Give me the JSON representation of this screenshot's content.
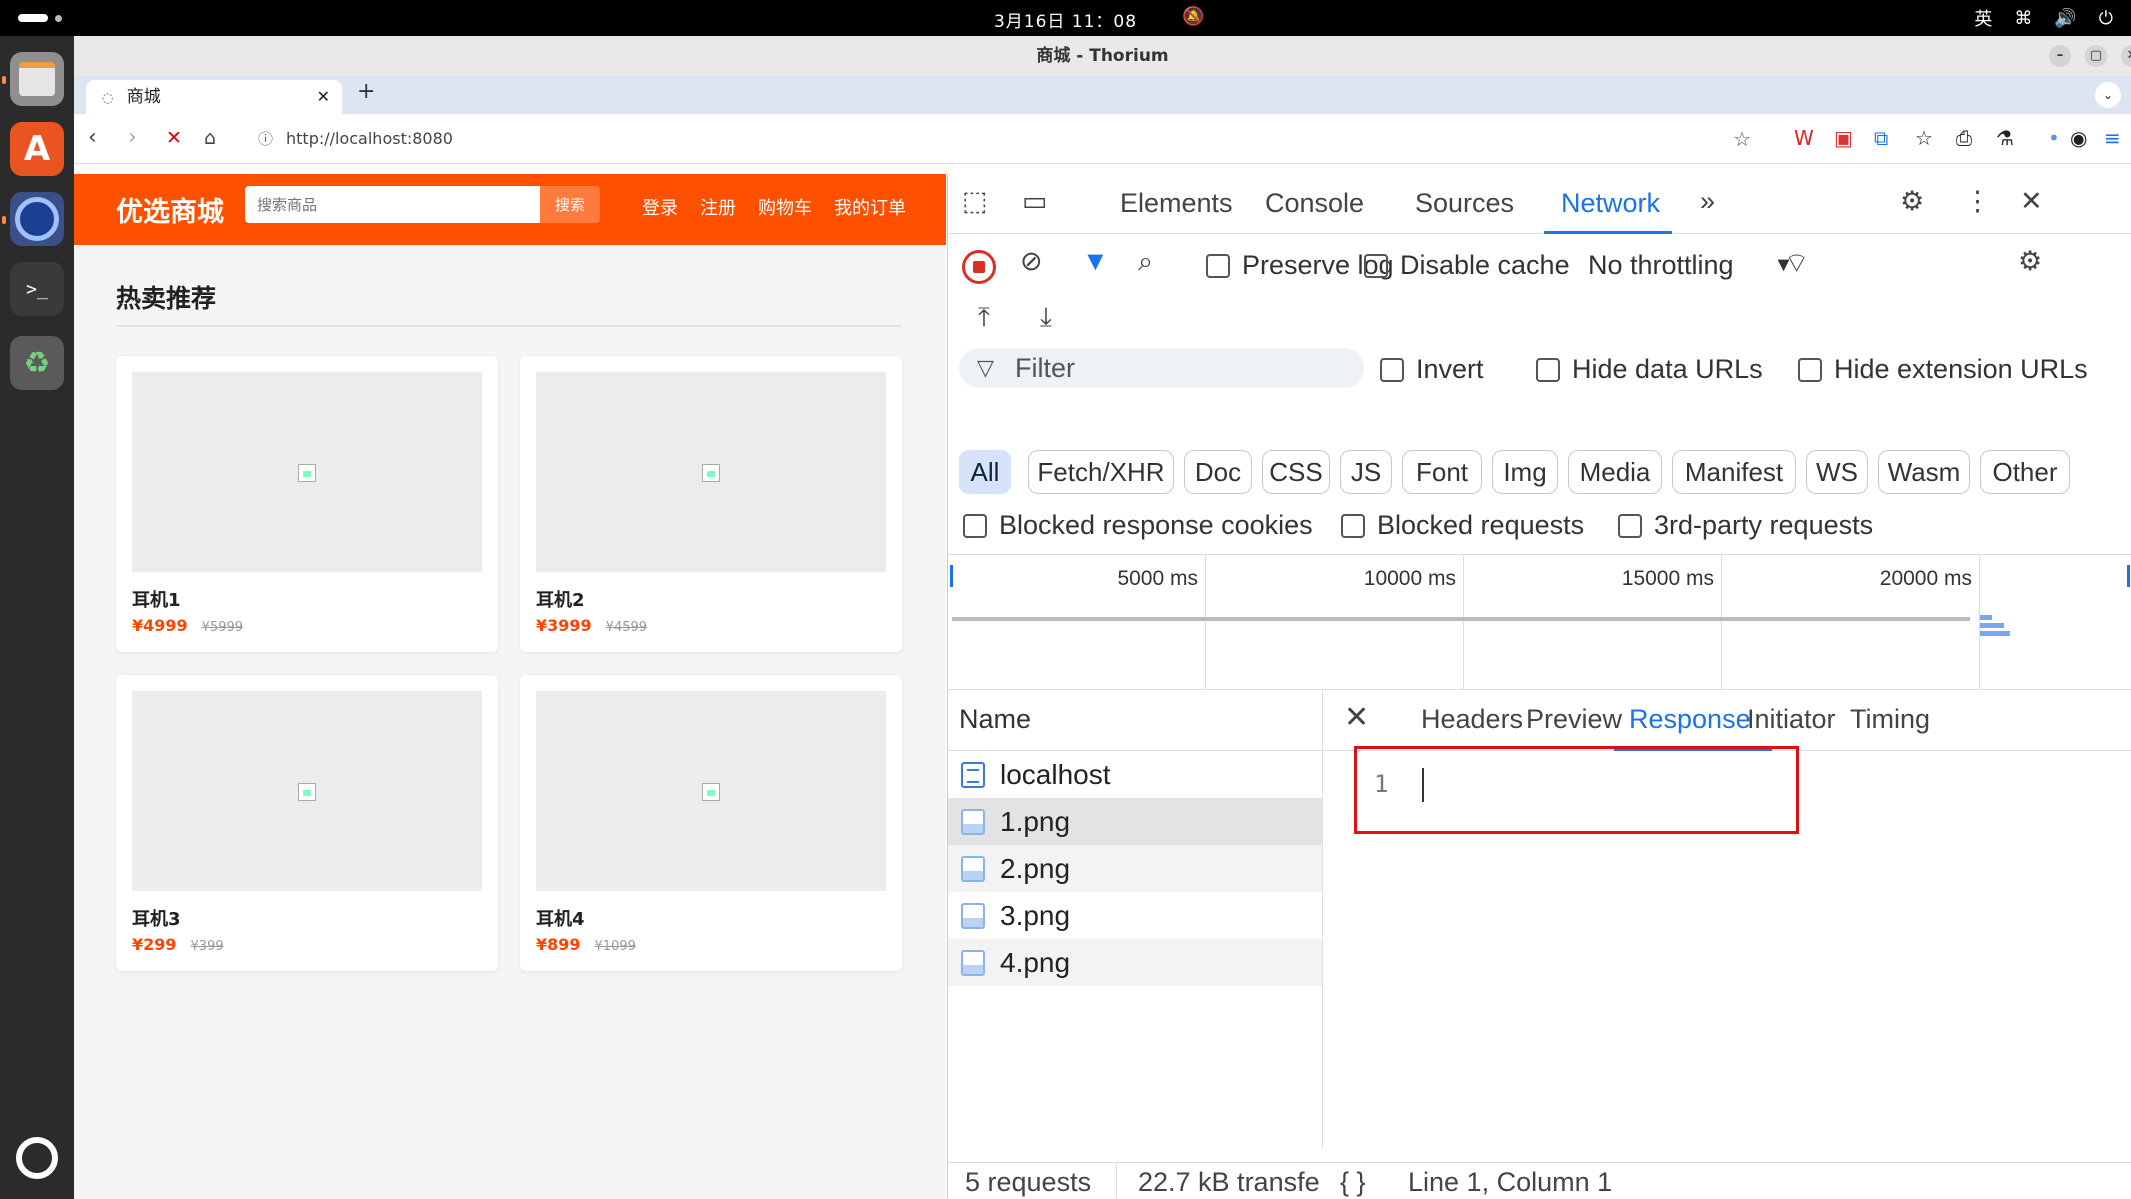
{
  "os": {
    "clock": "3月16日 11：08",
    "input_method": "英"
  },
  "window": {
    "title": "商城 - Thorium"
  },
  "tab": {
    "title": "商城"
  },
  "address_bar": {
    "url": "http://localhost:8080"
  },
  "shop": {
    "logo": "优选商城",
    "search_placeholder": "搜索商品",
    "search_button": "搜索",
    "nav": [
      "登录",
      "注册",
      "购物车",
      "我的订单"
    ],
    "section_title": "热卖推荐",
    "products": [
      {
        "name": "耳机1",
        "price": "¥4999",
        "original_price": "¥5999"
      },
      {
        "name": "耳机2",
        "price": "¥3999",
        "original_price": "¥4599"
      },
      {
        "name": "耳机3",
        "price": "¥299",
        "original_price": "¥399"
      },
      {
        "name": "耳机4",
        "price": "¥899",
        "original_price": "¥1099"
      }
    ]
  },
  "devtools": {
    "tabs": [
      "Elements",
      "Console",
      "Sources",
      "Network"
    ],
    "active_tab": "Network",
    "network": {
      "preserve_log": "Preserve log",
      "disable_cache": "Disable cache",
      "throttling": "No throttling",
      "filter_placeholder": "Filter",
      "invert": "Invert",
      "hide_data_urls": "Hide data URLs",
      "hide_extension_urls": "Hide extension URLs",
      "type_filters": [
        "All",
        "Fetch/XHR",
        "Doc",
        "CSS",
        "JS",
        "Font",
        "Img",
        "Media",
        "Manifest",
        "WS",
        "Wasm",
        "Other"
      ],
      "active_filter": "All",
      "blocked_response_cookies": "Blocked response cookies",
      "blocked_requests": "Blocked requests",
      "third_party_requests": "3rd-party requests",
      "timeline_ticks": [
        "5000 ms",
        "10000 ms",
        "15000 ms",
        "20000 ms"
      ],
      "name_column": "Name",
      "requests": [
        {
          "name": "localhost",
          "type": "document"
        },
        {
          "name": "1.png",
          "type": "image"
        },
        {
          "name": "2.png",
          "type": "image"
        },
        {
          "name": "3.png",
          "type": "image"
        },
        {
          "name": "4.png",
          "type": "image"
        }
      ],
      "selected_request": "1.png",
      "detail_tabs": [
        "Headers",
        "Preview",
        "Response",
        "Initiator",
        "Timing"
      ],
      "active_detail_tab": "Response",
      "response_line_number": "1",
      "status": {
        "requests": "5 requests",
        "transferred": "22.7 kB transfe",
        "cursor": "Line 1, Column 1"
      }
    }
  },
  "colors": {
    "brand": "#ff5000",
    "devtools_accent": "#1a73e8",
    "highlight": "#e01010"
  }
}
